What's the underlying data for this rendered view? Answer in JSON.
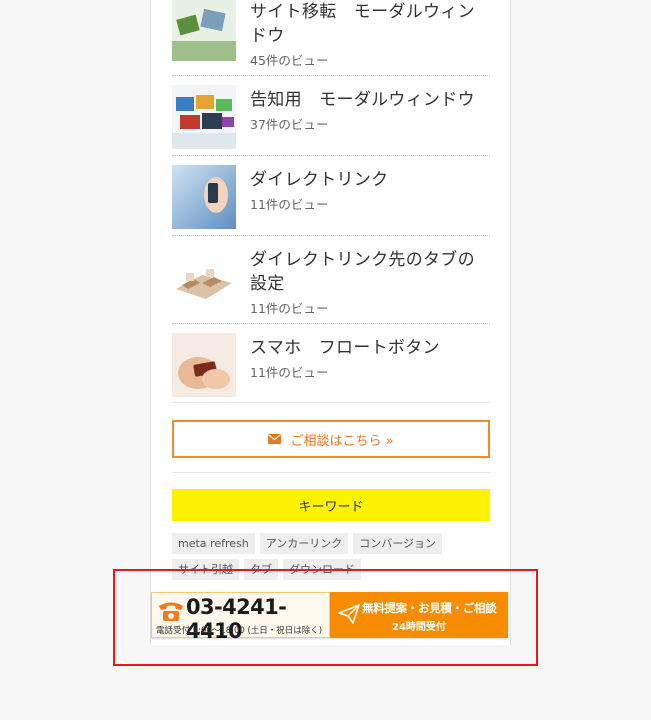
{
  "posts": [
    {
      "title": "サイト移転　モーダルウィンドウ",
      "views": "45件のビュー"
    },
    {
      "title": "告知用　モーダルウィンドウ",
      "views": "37件のビュー"
    },
    {
      "title": "ダイレクトリンク",
      "views": "11件のビュー"
    },
    {
      "title": "ダイレクトリンク先のタブの設定",
      "views": "11件のビュー"
    },
    {
      "title": "スマホ　フロートボタン",
      "views": "11件のビュー"
    }
  ],
  "consult": {
    "label": "ご相談はこちら »"
  },
  "keywords": {
    "heading": "キーワード",
    "tags": [
      "meta refresh",
      "アンカーリンク",
      "コンバージョン",
      "サイト引越",
      "タブ",
      "ダウンロード"
    ]
  },
  "banner": {
    "phone": "03-4241-4410",
    "hours": "電話受付 9:00〜18:00 (土日・祝日は除く)",
    "cta_main": "無料提案・お見積・ご相談",
    "cta_sub": "24時間受付"
  },
  "colors": {
    "accent": "#f08a2b",
    "keyword_bg": "#fff200",
    "cta_bg": "#f78c00",
    "highlight": "#e51a1a"
  }
}
